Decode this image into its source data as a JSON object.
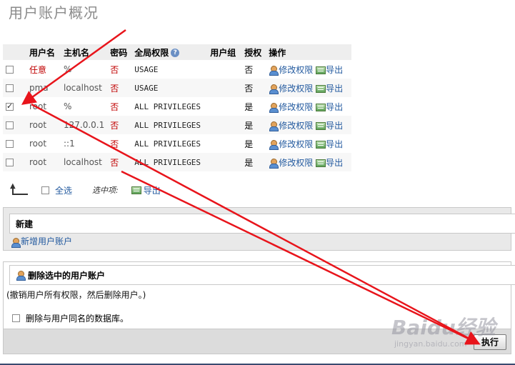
{
  "page": {
    "title": "用户账户概况"
  },
  "table": {
    "headers": [
      "用户名",
      "主机名",
      "密码",
      "全局权限",
      "用户组",
      "授权",
      "操作"
    ],
    "rows": [
      {
        "checked": false,
        "user": "任意",
        "host": "%",
        "password": "否",
        "privileges": "USAGE",
        "group": "",
        "grant": "否",
        "edit": "修改权限",
        "export": "导出"
      },
      {
        "checked": false,
        "user": "pma",
        "host": "localhost",
        "password": "否",
        "privileges": "USAGE",
        "group": "",
        "grant": "否",
        "edit": "修改权限",
        "export": "导出"
      },
      {
        "checked": true,
        "user": "root",
        "host": "%",
        "password": "否",
        "privileges": "ALL PRIVILEGES",
        "group": "",
        "grant": "是",
        "edit": "修改权限",
        "export": "导出"
      },
      {
        "checked": false,
        "user": "root",
        "host": "127.0.0.1",
        "password": "否",
        "privileges": "ALL PRIVILEGES",
        "group": "",
        "grant": "是",
        "edit": "修改权限",
        "export": "导出"
      },
      {
        "checked": false,
        "user": "root",
        "host": "::1",
        "password": "否",
        "privileges": "ALL PRIVILEGES",
        "group": "",
        "grant": "是",
        "edit": "修改权限",
        "export": "导出"
      },
      {
        "checked": false,
        "user": "root",
        "host": "localhost",
        "password": "否",
        "privileges": "ALL PRIVILEGES",
        "group": "",
        "grant": "是",
        "edit": "修改权限",
        "export": "导出"
      }
    ]
  },
  "bulk": {
    "select_all": "全选",
    "with_selected": "选中项:",
    "export": "导出"
  },
  "new_section": {
    "legend": "新建",
    "add_user": "新增用户账户"
  },
  "delete_section": {
    "legend": "删除选中的用户账户",
    "note": "(撤销用户所有权限，然后删除用户。)",
    "drop_db_label": "删除与用户同名的数据库。",
    "go_button": "执行"
  },
  "watermark": {
    "brand": "Baidu经验",
    "sub": "jingyan.baidu.com"
  },
  "colors": {
    "annotation_arrow": "#e8141b",
    "link": "#235a9f",
    "no_password": "#c00000"
  }
}
